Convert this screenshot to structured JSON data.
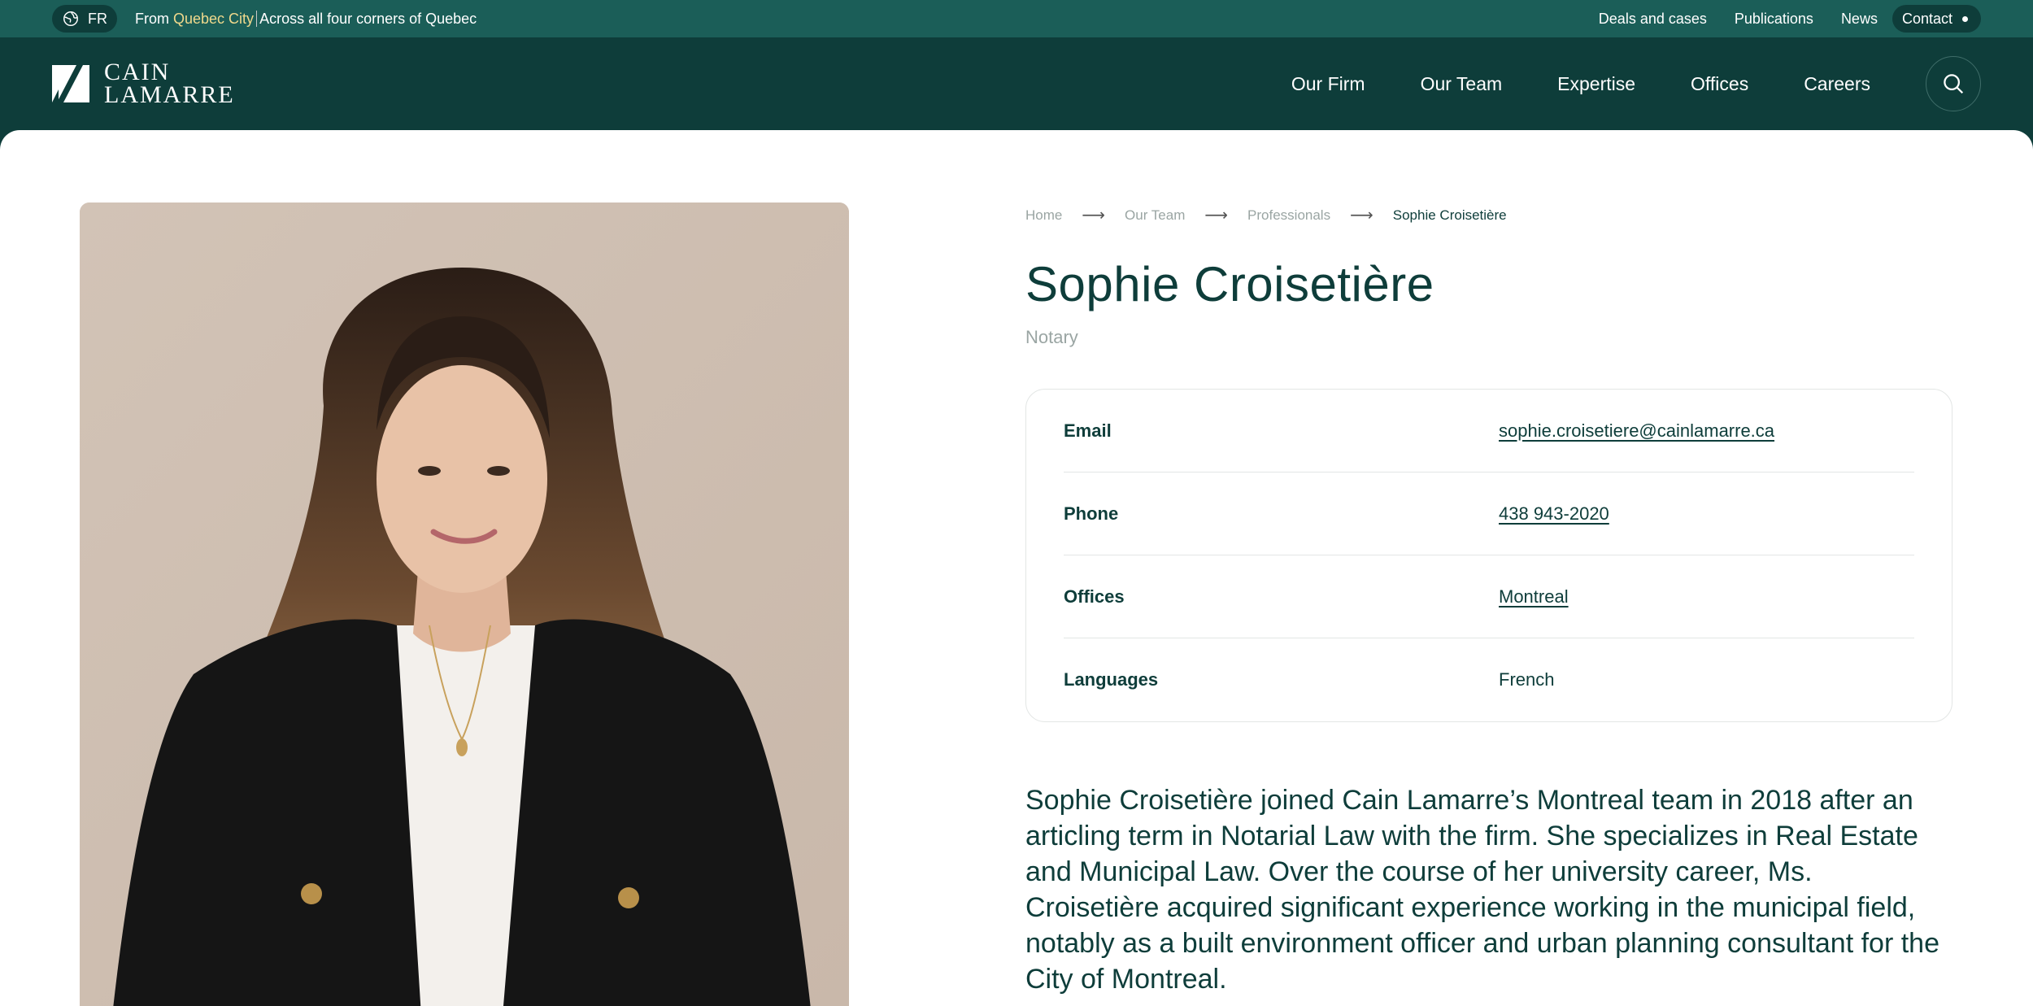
{
  "topbar": {
    "lang": "FR",
    "tagline_prefix": "From",
    "tagline_highlight": "Quebec City",
    "tagline_suffix": "Across all four corners of Quebec",
    "links": [
      "Deals and cases",
      "Publications",
      "News"
    ],
    "contact": "Contact"
  },
  "header": {
    "logo_line1": "CAIN",
    "logo_line2": "LAMARRE",
    "nav": [
      "Our Firm",
      "Our Team",
      "Expertise",
      "Offices",
      "Careers"
    ]
  },
  "breadcrumb": {
    "items": [
      "Home",
      "Our Team",
      "Professionals"
    ],
    "current": "Sophie Croisetière",
    "separator": "⟶"
  },
  "profile": {
    "name": "Sophie Croisetière",
    "role": "Notary",
    "info": [
      {
        "label": "Email",
        "value": "sophie.croisetiere@cainlamarre.ca"
      },
      {
        "label": "Phone",
        "value": "438 943-2020"
      },
      {
        "label": "Offices",
        "value": "Montreal"
      },
      {
        "label": "Languages",
        "value": "French"
      }
    ],
    "bio": "Sophie Croisetière joined Cain Lamarre’s Montreal team in 2018 after an articling term in Notarial Law with the firm. She specializes in Real Estate and Municipal Law. Over the course of her university career, Ms. Croisetière acquired significant experience working in the municipal field, notably as a built environment officer and urban planning consultant for the City of Montreal."
  },
  "colors": {
    "brand_dark": "#0e3d3a",
    "topbar": "#1b5e58",
    "highlight": "#f0d98c"
  }
}
